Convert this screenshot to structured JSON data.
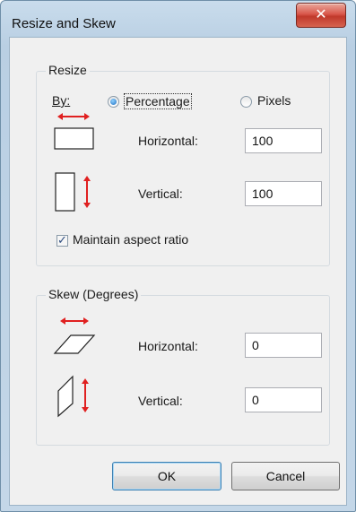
{
  "window": {
    "title": "Resize and Skew",
    "close_glyph": "✕"
  },
  "resize": {
    "group_label": "Resize",
    "by_label": "By:",
    "percentage_label": "Percentage",
    "pixels_label": "Pixels",
    "selected": "percentage",
    "horizontal_label": "Horizontal:",
    "horizontal_value": "100",
    "vertical_label": "Vertical:",
    "vertical_value": "100",
    "maintain_label": "Maintain aspect ratio",
    "maintain_checked": true
  },
  "skew": {
    "group_label": "Skew (Degrees)",
    "horizontal_label": "Horizontal:",
    "horizontal_value": "0",
    "vertical_label": "Vertical:",
    "vertical_value": "0"
  },
  "buttons": {
    "ok": "OK",
    "cancel": "Cancel"
  },
  "colors": {
    "arrow": "#e02020",
    "title_bg": "#c4d7e8",
    "dialog_bg": "#f0f0f0",
    "close": "#c0392b"
  },
  "icons": {
    "close": "close-icon",
    "resize_h": "resize-horizontal-icon",
    "resize_v": "resize-vertical-icon",
    "skew_h": "skew-horizontal-icon",
    "skew_v": "skew-vertical-icon"
  }
}
